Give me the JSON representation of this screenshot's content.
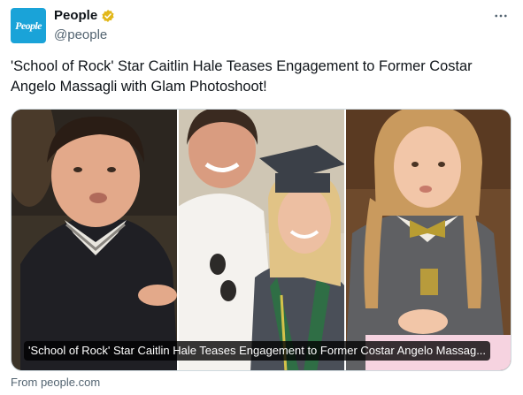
{
  "account": {
    "avatar_text": "People",
    "display_name": "People",
    "handle": "@people",
    "verified_icon": "verified-badge-icon",
    "more_icon": "more-horizontal-icon"
  },
  "tweet": {
    "text": "'School of Rock' Star Caitlin Hale Teases Engagement to Former Costar Angelo Massagli with Glam Photoshoot!"
  },
  "card": {
    "title": "'School of Rock' Star Caitlin Hale Teases Engagement to Former Costar Angelo Massag...",
    "source": "From people.com"
  },
  "colors": {
    "accent": "#1d9bf0",
    "verified_gold": "#e2b719",
    "avatar_bg": "#1aa3d8",
    "text_primary": "#0f1419",
    "text_secondary": "#536471"
  }
}
